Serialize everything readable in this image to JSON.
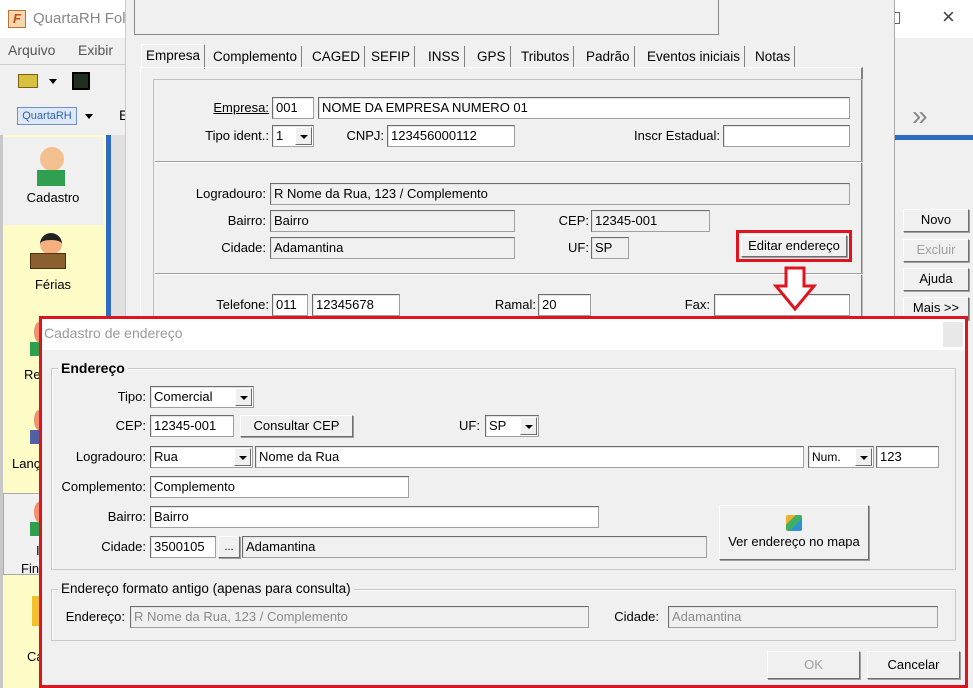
{
  "main_window": {
    "title": "QuartaRH Folh",
    "menu": [
      "Arquivo",
      "Exibir"
    ],
    "toolbar_logo": "QuartaRH",
    "toolbar_partial": "E"
  },
  "sidebar": {
    "items": [
      {
        "label": "Cadastro",
        "icon": "person-suit-icon"
      },
      {
        "label": "Férias",
        "icon": "vacation-luggage-icon"
      },
      {
        "label": "Re",
        "icon": "person-icon"
      },
      {
        "label": "Lanç",
        "icon": "person-icon"
      },
      {
        "label": "Fin",
        "label_top": "I",
        "icon": "person-icon"
      },
      {
        "label": "Ca",
        "icon": "folder-icon"
      }
    ]
  },
  "right_panel": {
    "buttons": [
      "Novo",
      "Excluir",
      "Ajuda",
      "Mais >>"
    ],
    "nav_glyph": "»"
  },
  "empresa_dialog": {
    "tabs": [
      "Empresa",
      "Complemento",
      "CAGED",
      "SEFIP",
      "INSS",
      "GPS",
      "Tributos",
      "Padrão",
      "Eventos iniciais",
      "Notas"
    ],
    "active_tab": "Empresa",
    "empresa_label": "Empresa:",
    "empresa_code": "001",
    "empresa_name": "NOME DA EMPRESA NUMERO 01",
    "tipo_ident_label": "Tipo ident.:",
    "tipo_ident": "1",
    "cnpj_label": "CNPJ:",
    "cnpj": "123456000112",
    "inscr_label": "Inscr Estadual:",
    "inscr": "",
    "logradouro_label": "Logradouro:",
    "logradouro": "R Nome da Rua, 123 / Complemento",
    "bairro_label": "Bairro:",
    "bairro": "Bairro",
    "cep_label": "CEP:",
    "cep": "12345-001",
    "cidade_label": "Cidade:",
    "cidade": "Adamantina",
    "uf_label": "UF:",
    "uf": "SP",
    "editar_button": "Editar endereço",
    "telefone_label": "Telefone:",
    "ddd": "011",
    "telefone": "12345678",
    "ramal_label": "Ramal:",
    "ramal": "20",
    "fax_label": "Fax:",
    "fax": ""
  },
  "highlight_color": "#e0141e",
  "endereco_dialog": {
    "title": "Cadastro de endereço",
    "group_title": "Endereço",
    "tipo_label": "Tipo:",
    "tipo": "Comercial",
    "cep_label": "CEP:",
    "cep": "12345-001",
    "consultar_button": "Consultar CEP",
    "uf_label": "UF:",
    "uf": "SP",
    "logradouro_label": "Logradouro:",
    "logradouro_tipo": "Rua",
    "logradouro": "Nome da Rua",
    "num_tipo": "Num.",
    "numero": "123",
    "complemento_label": "Complemento:",
    "complemento": "Complemento",
    "bairro_label": "Bairro:",
    "bairro": "Bairro",
    "cidade_label": "Cidade:",
    "cidade_code": "3500105",
    "browse_button": "...",
    "cidade": "Adamantina",
    "mapa_button": "Ver endereço no mapa",
    "old_group_title": "Endereço formato antigo (apenas para consulta)",
    "old_endereco_label": "Endereço:",
    "old_endereco": "R Nome da Rua, 123 / Complemento",
    "old_cidade_label": "Cidade:",
    "old_cidade": "Adamantina",
    "ok_button": "OK",
    "cancel_button": "Cancelar"
  }
}
